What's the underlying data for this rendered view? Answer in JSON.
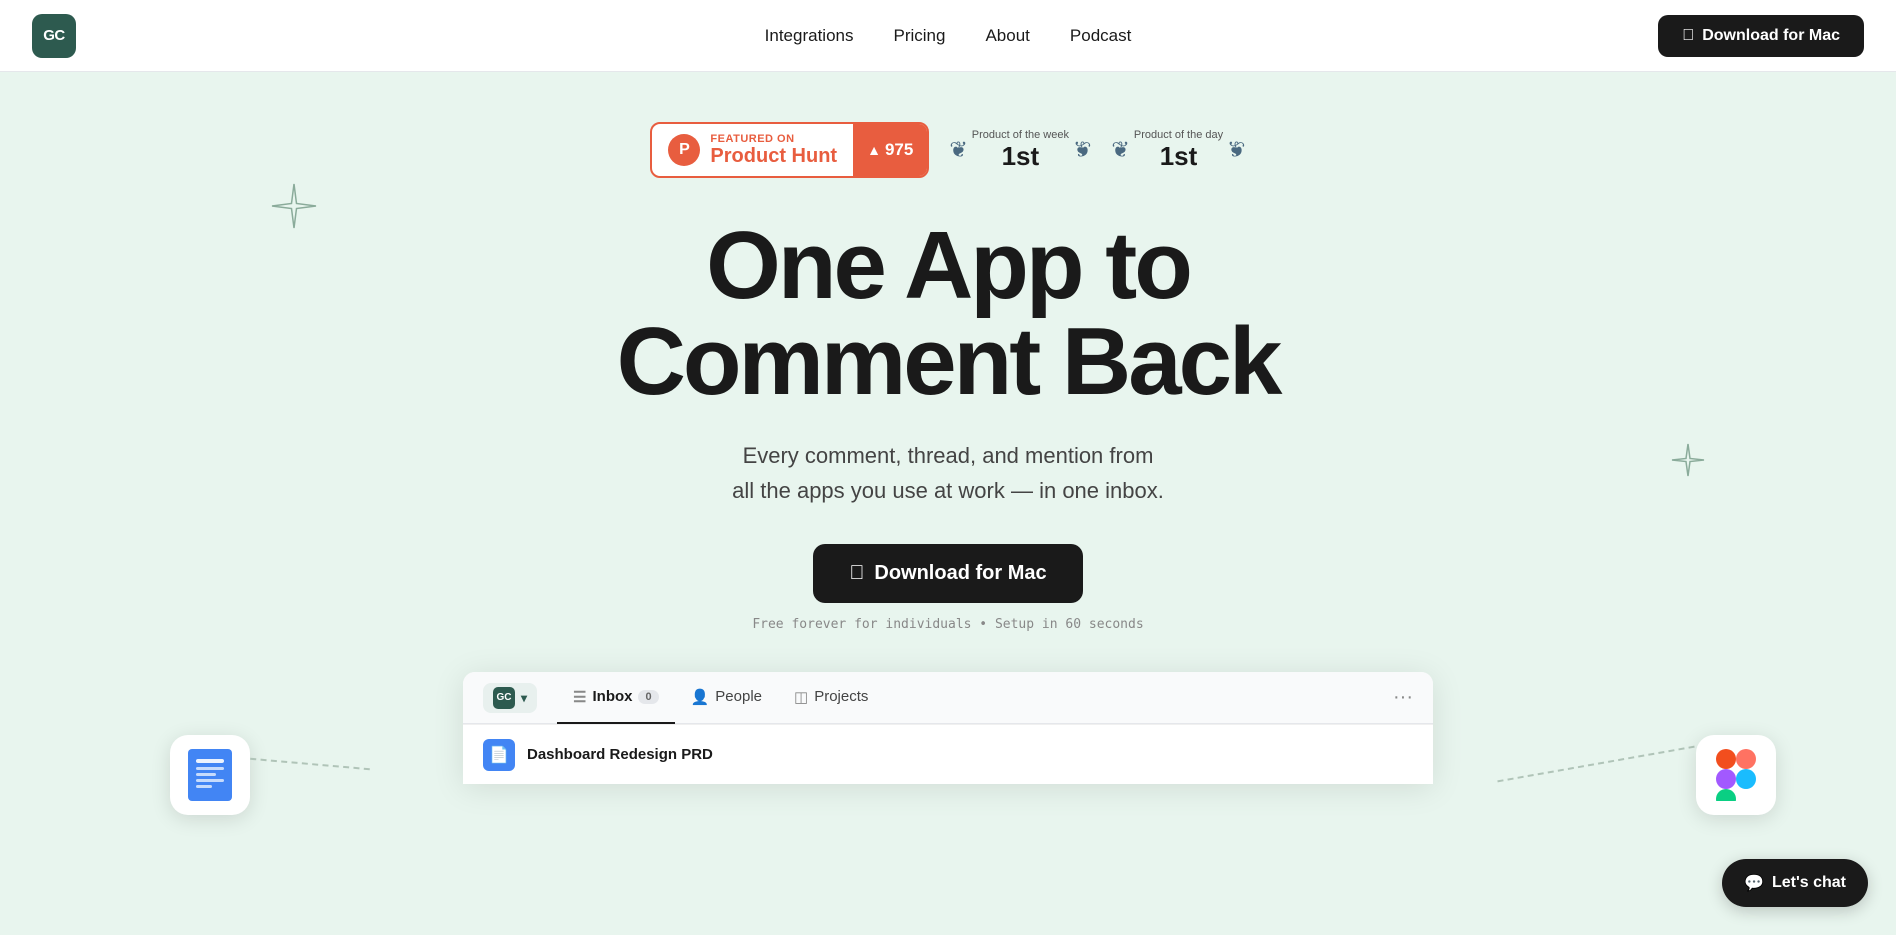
{
  "navbar": {
    "logo_text": "GC",
    "links": [
      {
        "label": "Integrations",
        "href": "#"
      },
      {
        "label": "Pricing",
        "href": "#"
      },
      {
        "label": "About",
        "href": "#"
      },
      {
        "label": "Podcast",
        "href": "#"
      }
    ],
    "download_label": "Download for Mac"
  },
  "hero": {
    "ph_badge": {
      "featured_on": "FEATURED ON",
      "product_hunt": "Product Hunt",
      "vote_count": "975"
    },
    "award_week": {
      "label": "Product of the week",
      "rank": "1st"
    },
    "award_day": {
      "label": "Product of the day",
      "rank": "1st"
    },
    "headline_line1": "One App to",
    "headline_line2": "Comment Back",
    "subtext_line1": "Every comment, thread, and mention from",
    "subtext_line2": "all the apps you use at work — in one inbox.",
    "download_label": "Download for Mac",
    "fine_print": "Free forever for individuals • Setup in 60 seconds",
    "app_preview": {
      "logo": "GC",
      "tabs": [
        {
          "label": "Inbox",
          "icon": "☰",
          "badge": "0",
          "active": true
        },
        {
          "label": "People",
          "icon": "👤",
          "active": false
        },
        {
          "label": "Projects",
          "icon": "◫",
          "active": false
        }
      ],
      "more_icon": "···",
      "list_item": {
        "title": "Dashboard Redesign PRD"
      }
    },
    "chat_button": "Let's chat"
  }
}
